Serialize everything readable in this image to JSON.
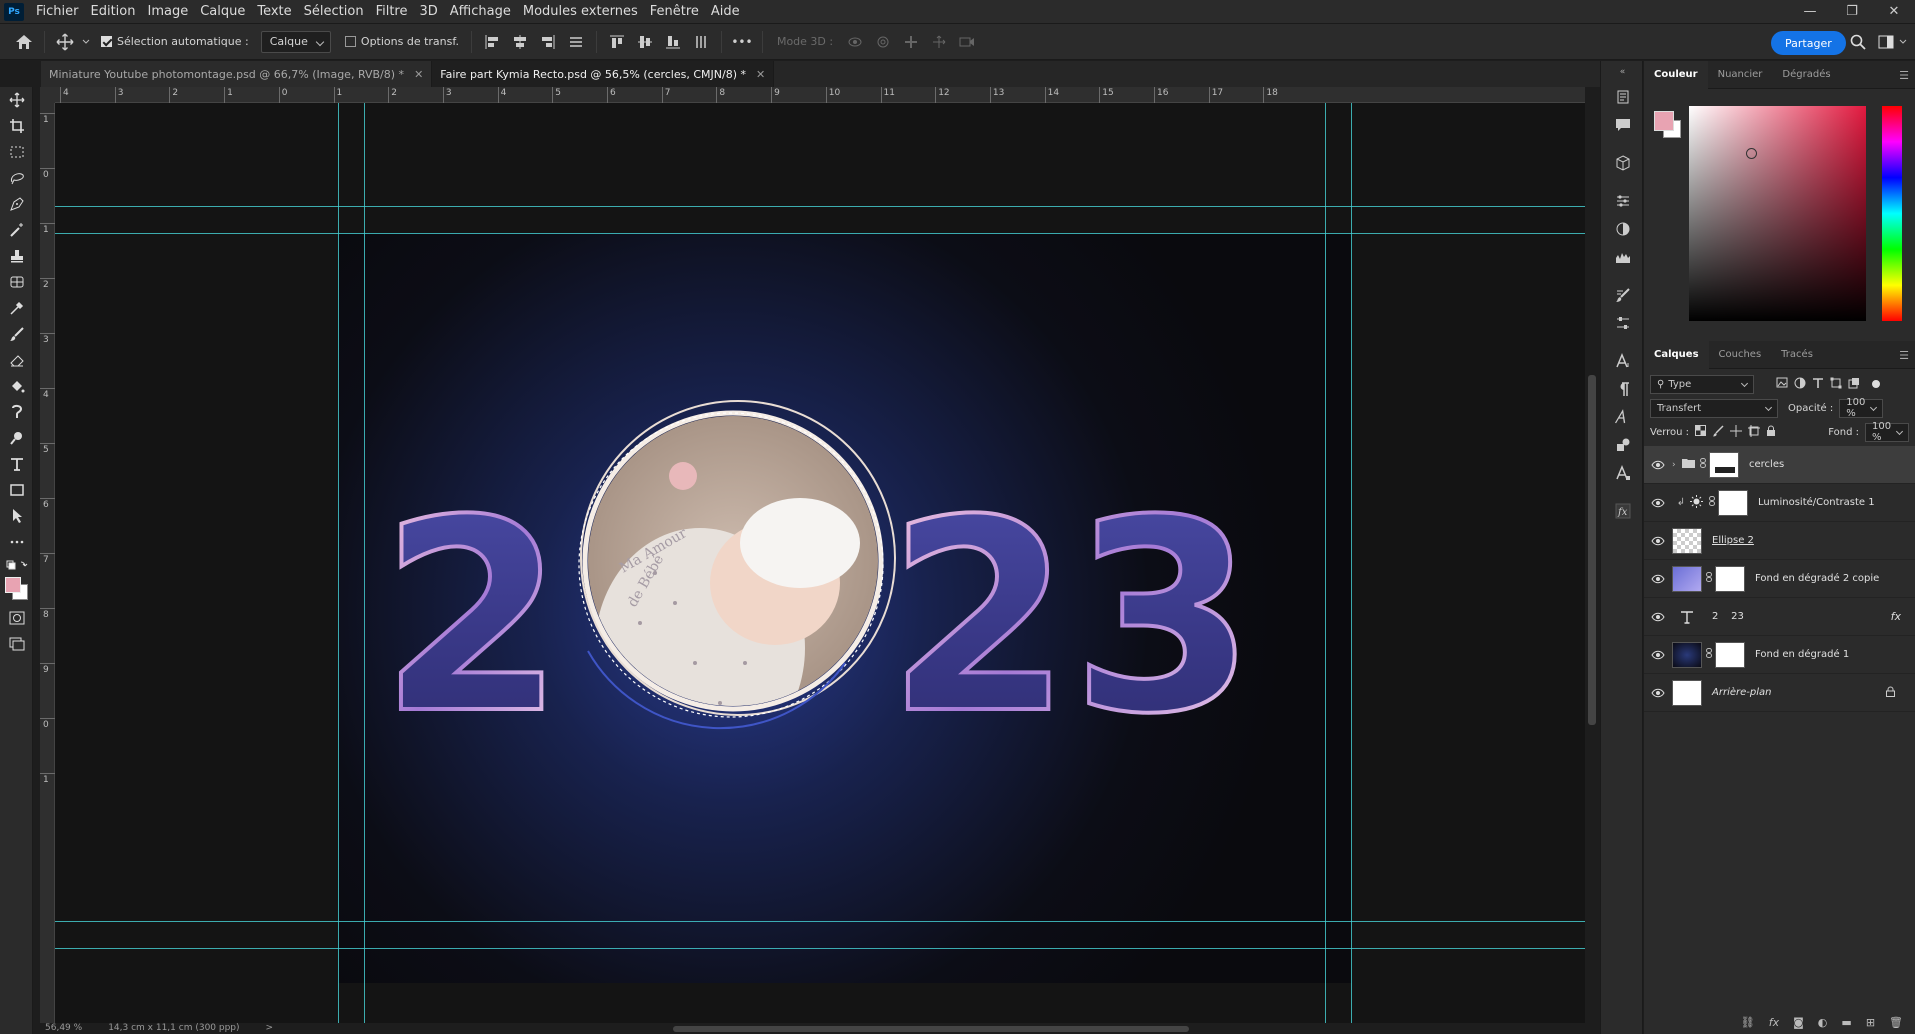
{
  "app": {
    "logo": "Ps"
  },
  "menu": [
    "Fichier",
    "Edition",
    "Image",
    "Calque",
    "Texte",
    "Sélection",
    "Filtre",
    "3D",
    "Affichage",
    "Modules externes",
    "Fenêtre",
    "Aide"
  ],
  "window": {
    "minimize": "—",
    "restore": "❐",
    "close": "✕"
  },
  "options": {
    "auto_select_label": "Sélection automatique :",
    "auto_select_checked": true,
    "auto_select_target": "Calque",
    "transform_label": "Options de transf.",
    "mode3d": "Mode 3D :",
    "more": "•••",
    "share": "Partager"
  },
  "tabs": [
    {
      "label": "Miniature Youtube photomontage.psd @ 66,7% (Image, RVB/8) *",
      "active": false
    },
    {
      "label": "Faire part Kymia Recto.psd @ 56,5% (cercles, CMJN/8) *",
      "active": true
    }
  ],
  "ruler_h": [
    "4",
    "3",
    "2",
    "1",
    "0",
    "1",
    "2",
    "3",
    "4",
    "5",
    "6",
    "7",
    "8",
    "9",
    "10",
    "11",
    "12",
    "13",
    "14",
    "15",
    "16",
    "17",
    "18"
  ],
  "ruler_v": [
    "1",
    "0",
    "1",
    "2",
    "3",
    "4",
    "5",
    "6",
    "7",
    "8",
    "9",
    "0",
    "1"
  ],
  "artwork": {
    "year_left": "2",
    "year_right": "23",
    "photo_text_1": "Ma Amour",
    "photo_text_2": "de Bébé"
  },
  "status": {
    "zoom": "56,49 %",
    "doc": "14,3 cm x 11,1 cm (300 ppp)",
    "arrow": ">"
  },
  "color_panel": {
    "tabs": [
      "Couleur",
      "Nuancier",
      "Dégradés"
    ],
    "foreground": "#e8a3b2",
    "background": "#ffffff"
  },
  "layers_panel": {
    "tabs": [
      "Calques",
      "Couches",
      "Tracés"
    ],
    "filter": "Type",
    "blend_mode": "Transfert",
    "opacity_label": "Opacité :",
    "opacity": "100 %",
    "lock_label": "Verrou :",
    "fill_label": "Fond :",
    "fill": "100 %",
    "layers": [
      {
        "name": "cercles",
        "type": "group",
        "selected": true
      },
      {
        "name": "Luminosité/Contraste 1",
        "type": "adjustment"
      },
      {
        "name": "Ellipse 2",
        "type": "shape"
      },
      {
        "name": "Fond en dégradé 2 copie",
        "type": "gradient"
      },
      {
        "name": "2    23",
        "type": "text",
        "fx": "fx"
      },
      {
        "name": "Fond en dégradé 1",
        "type": "dark"
      },
      {
        "name": "Arrière-plan",
        "type": "background"
      }
    ]
  },
  "colors": {
    "accent": "#1473e6",
    "guide": "#46d2d6",
    "year_fill": "#3b3a8a"
  }
}
